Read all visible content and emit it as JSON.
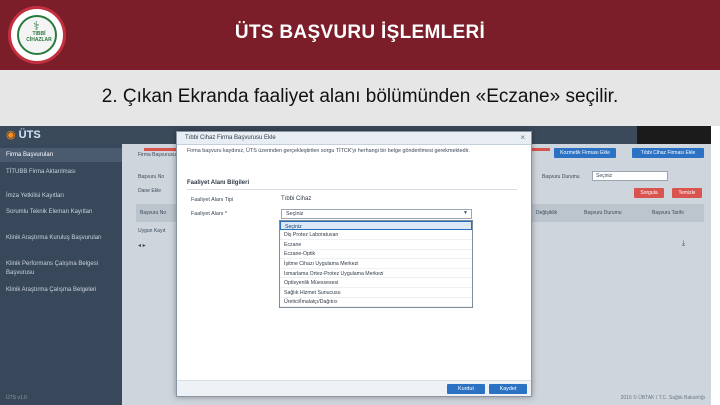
{
  "slide": {
    "title": "ÜTS BAŞVURU İŞLEMLERİ",
    "subtitle": "2. Çıkan Ekranda faaliyet alanı bölümünden «Eczane» seçilir.",
    "logo_text": "TIBBİ CİHAZLAR",
    "colors": {
      "header": "#7b1e2a",
      "band": "#e6e6e6"
    }
  },
  "app": {
    "logo": "ÜTS",
    "sidebar": [
      "Firma Başvuruları",
      "TİTUBB Firma Aktarılması",
      "İmza Yetkilisi Kayıtları",
      "Sorumlu Teknik Eleman Kayıtları",
      "Klinik Araştırma Kuruluş Başvuruları",
      "Klinik Performans Çalışma Belgesi Başvurusu",
      "Klinik Araştırma Çalışma Belgeleri"
    ],
    "sidebar_footer": "ÜTS v1.0",
    "content": {
      "breadcrumb": "Firma Başvurusu",
      "search_label": "Başvuru No",
      "new_label": "Dane Ekle",
      "btn_left": "Kozmetik Firması Ekle",
      "btn_right": "Tıbbi Cihaz Firması Ekle",
      "status_label": "Başvuru Durumu",
      "status_value": "Seçiniz",
      "search_btn": "Sorgula",
      "clear_btn": "Temizle",
      "col_basvuru": "Başvuru No",
      "col_durum": "Başvuru Durumu",
      "col_tarih": "Başvuru Tarihi",
      "col_degisiklik": "Değişiklik",
      "empty_text": "Uygun Kayıt",
      "footer": "2016 © ÜBTAK / T.C. Sağlık Bakanlığı"
    },
    "modal": {
      "title": "Tıbbi Cihaz Firma Başvurusu Ekle",
      "close": "×",
      "message": "Firma başvuru kaydınız, ÜTS üzerinden gerçekleştirilen sorgu TİTCK'yi herhangi bir belge gönderilmesi gerekmektedir.",
      "section": "Faaliyet Alanı Bilgileri",
      "field1_label": "Faaliyet Alanı Tipi",
      "field1_value": "Tıbbi Cihaz",
      "field2_label": "Faaliyet Alanı *",
      "select_value": "Seçiniz",
      "options": [
        "Seçiniz",
        "Diş Protez Laboratuvarı",
        "Eczane",
        "Eczane-Optik",
        "İşitme Cihazı Uygulama Merkezi",
        "Ismarlama Ortez-Protez Uygulama Merkezi",
        "Optisyenlik Müessesesi",
        "Sağlık Hizmet Sunucusu",
        "Üretici/İmalatçı/Dağıtıcı"
      ],
      "btn_cancel": "Kurdut",
      "btn_save": "Kaydet"
    }
  }
}
